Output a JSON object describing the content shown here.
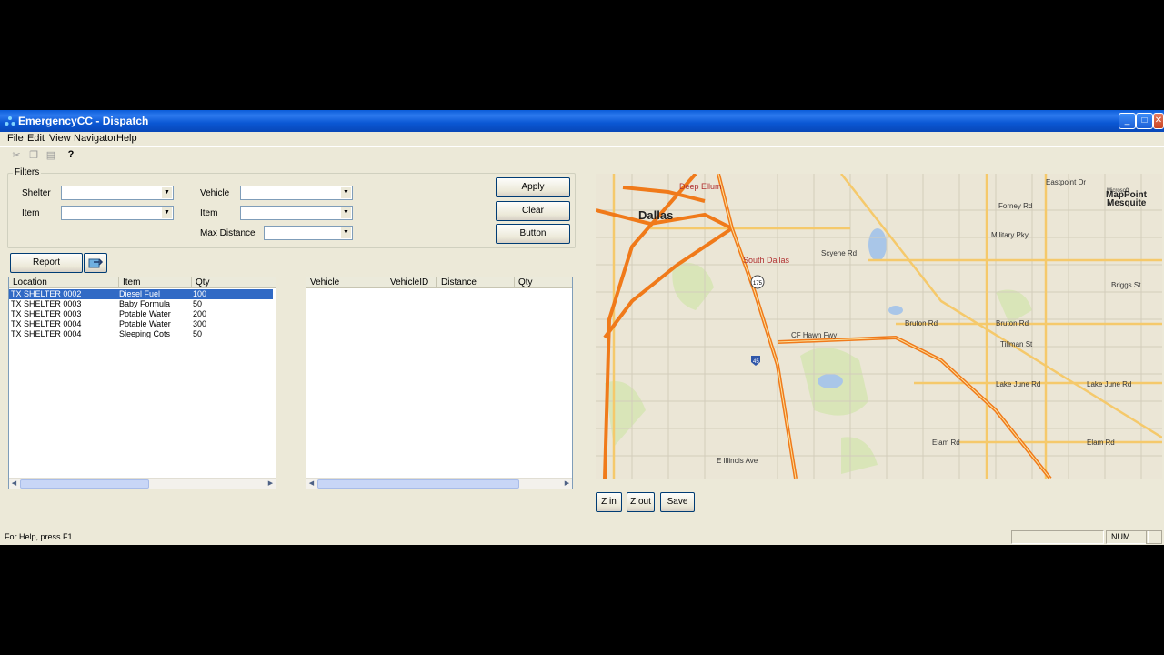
{
  "window": {
    "title": "EmergencyCC - Dispatch",
    "minimize": "_",
    "maximize": "□",
    "close": "✕"
  },
  "menu": [
    "File",
    "Edit",
    "View",
    "Navigator",
    "Help"
  ],
  "filters": {
    "legend": "Filters",
    "shelter_label": "Shelter",
    "shelter_value": "",
    "item_label": "Item",
    "item_value": "",
    "vehicle_label": "Vehicle",
    "vehicle_value": "",
    "item2_label": "Item",
    "item2_value": "",
    "max_distance_label": "Max Distance",
    "max_distance_value": ""
  },
  "buttons": {
    "apply": "Apply",
    "clear": "Clear",
    "button": "Button",
    "report": "Report",
    "zoom_in": "Z in",
    "zoom_out": "Z out",
    "save": "Save"
  },
  "inventory": {
    "columns": [
      "Location",
      "Item",
      "Qty"
    ],
    "rows": [
      [
        "TX SHELTER 0002",
        "Diesel Fuel",
        "100"
      ],
      [
        "TX SHELTER 0003",
        "Baby Formula",
        "50"
      ],
      [
        "TX SHELTER 0003",
        "Potable Water",
        "200"
      ],
      [
        "TX SHELTER 0004",
        "Potable Water",
        "300"
      ],
      [
        "TX SHELTER 0004",
        "Sleeping Cots",
        "50"
      ]
    ],
    "selected_row": 0
  },
  "vehicles": {
    "columns": [
      "Vehicle",
      "VehicleID",
      "Distance",
      "Qty"
    ],
    "rows": []
  },
  "map": {
    "brand_small": "Microsoft",
    "brand": "MapPoint",
    "labels": {
      "dallas": "Dallas",
      "south_dallas": "South Dallas",
      "mesquite": "Mesquite",
      "deep_ellum": "Deep Ellum",
      "scyene_rd": "Scyene Rd",
      "bruton_rd": "Bruton Rd",
      "military_pky": "Military Pky",
      "forney_rd": "Forney Rd",
      "cf_hawn_fwy": "CF Hawn Fwy",
      "lake_june_rd": "Lake June Rd",
      "elam_rd": "Elam Rd",
      "i45": "45",
      "i20": "175",
      "illinois_ave": "E Illinois Ave",
      "tillman_st": "Tillman St",
      "eastpoint_dr": "Eastpoint Dr",
      "briggs_st": "Briggs St"
    }
  },
  "status": {
    "help": "For Help, press F1",
    "num": "NUM"
  },
  "colors": {
    "titlebar": "#0a57d3",
    "selection": "#316ac5",
    "highway": "#f07a1a",
    "major_road": "#f5c96b"
  }
}
